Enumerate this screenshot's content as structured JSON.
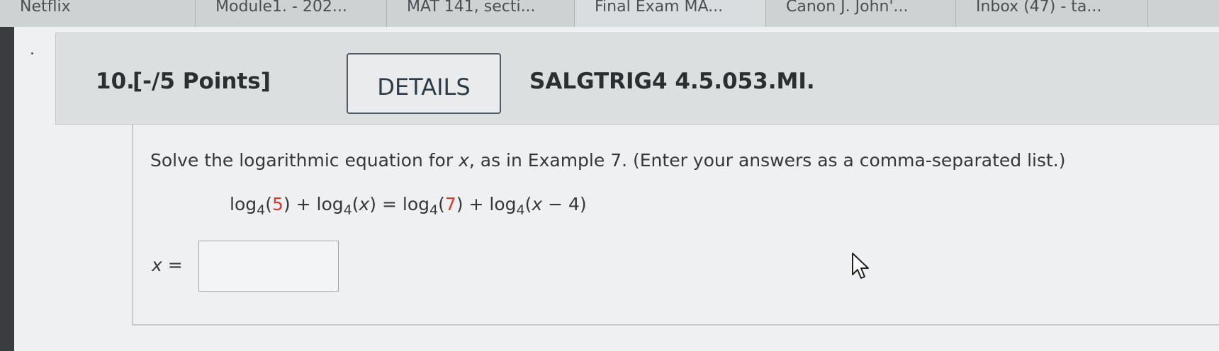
{
  "browser": {
    "tabs": [
      {
        "label": "Netflix",
        "width": 276
      },
      {
        "label": "Module1. - 202...",
        "width": 270
      },
      {
        "label": "MAT 141, secti...",
        "width": 265
      },
      {
        "label": "Final Exam MA...",
        "width": 270
      },
      {
        "label": "Canon J. John'...",
        "width": 268
      },
      {
        "label": "Inbox (47) - ta...",
        "width": 271
      }
    ]
  },
  "question": {
    "number": "10.",
    "points": "[-/5 Points]",
    "details_label": "DETAILS",
    "code": "SALGTRIG4 4.5.053.MI.",
    "prompt_before_var": "Solve the logarithmic equation for ",
    "prompt_var": "x",
    "prompt_after_var": ", as in Example 7. (Enter your answers as a comma-separated list.)",
    "equation": {
      "log": "log",
      "base": "4",
      "term1_arg": "5",
      "term2_arg": "x",
      "term3_arg": "7",
      "term4_var": "x",
      "term4_rest": " − 4",
      "plus": " + ",
      "equals": " = "
    },
    "answer_var": "x",
    "answer_eq": " =",
    "answer_value": ""
  }
}
